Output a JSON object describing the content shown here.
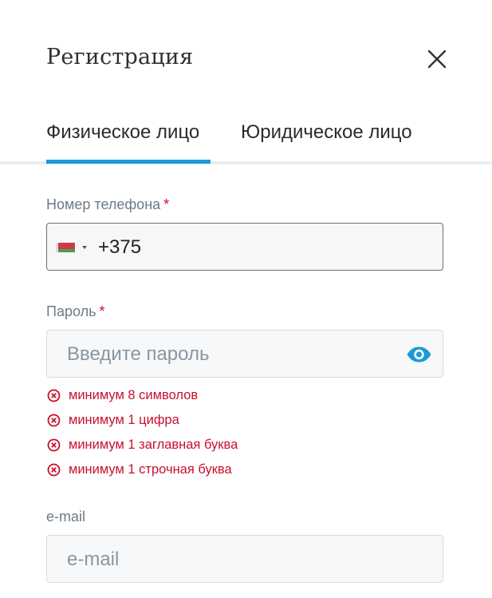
{
  "modal": {
    "title": "Регистрация"
  },
  "tabs": [
    {
      "label": "Физическое лицо",
      "active": true
    },
    {
      "label": "Юридическое лицо",
      "active": false
    }
  ],
  "colors": {
    "accent": "#1a9ad6",
    "error": "#c8102e",
    "label": "#6e7a85"
  },
  "phone": {
    "label": "Номер телефона",
    "required_mark": "*",
    "country_flag": "belarus-flag-icon",
    "value": "+375"
  },
  "password": {
    "label": "Пароль",
    "required_mark": "*",
    "placeholder": "Введите пароль",
    "toggle_icon": "eye-icon",
    "rules": [
      "минимум 8 символов",
      "минимум 1 цифра",
      "минимум 1 заглавная буква",
      "минимум 1 строчная буква"
    ]
  },
  "email": {
    "label": "e-mail",
    "placeholder": "e-mail"
  }
}
